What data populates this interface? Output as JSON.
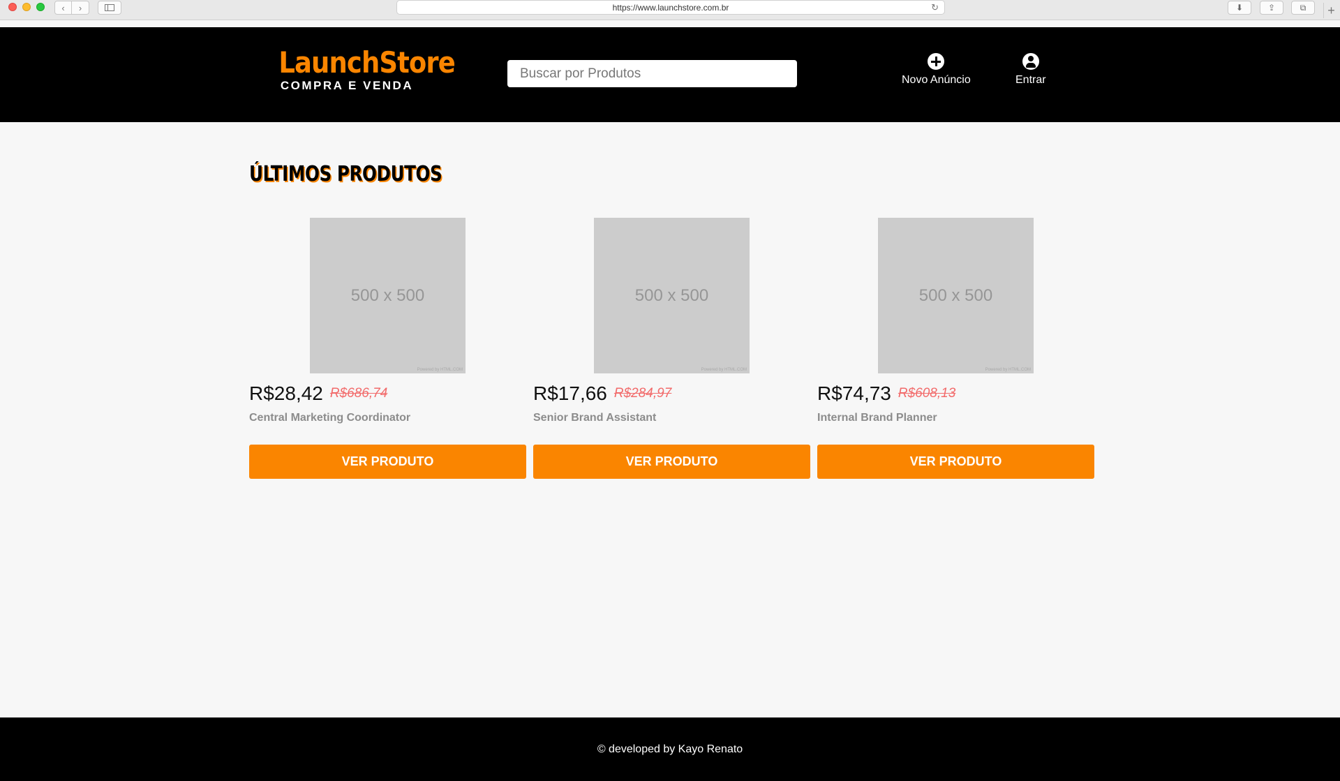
{
  "browser": {
    "url": "https://www.launchstore.com.br",
    "back_icon": "‹",
    "forward_icon": "›",
    "reload_icon": "↻",
    "download_icon": "⬇",
    "share_icon": "⇪",
    "tabs_icon": "⧉",
    "new_tab_icon": "+"
  },
  "header": {
    "logo_main": "LaunchStore",
    "logo_sub": "COMPRA E VENDA",
    "search_placeholder": "Buscar por Produtos",
    "new_ad_label": "Novo Anúncio",
    "login_label": "Entrar"
  },
  "main": {
    "section_title": "ÚLTIMOS PRODUTOS",
    "products": [
      {
        "image_text": "500 x 500",
        "image_credit": "Powered by HTML.COM",
        "price": "R$28,42",
        "old_price": "R$686,74",
        "name": "Central Marketing Coordinator",
        "button": "VER PRODUTO"
      },
      {
        "image_text": "500 x 500",
        "image_credit": "Powered by HTML.COM",
        "price": "R$17,66",
        "old_price": "R$284,97",
        "name": "Senior Brand Assistant",
        "button": "VER PRODUTO"
      },
      {
        "image_text": "500 x 500",
        "image_credit": "Powered by HTML.COM",
        "price": "R$74,73",
        "old_price": "R$608,13",
        "name": "Internal Brand Planner",
        "button": "VER PRODUTO"
      }
    ]
  },
  "footer": {
    "text": "© developed by Kayo Renato"
  },
  "colors": {
    "brand": "#fa8500",
    "header_bg": "#000000",
    "page_bg": "#f7f7f7",
    "old_price": "#f26b6b"
  }
}
